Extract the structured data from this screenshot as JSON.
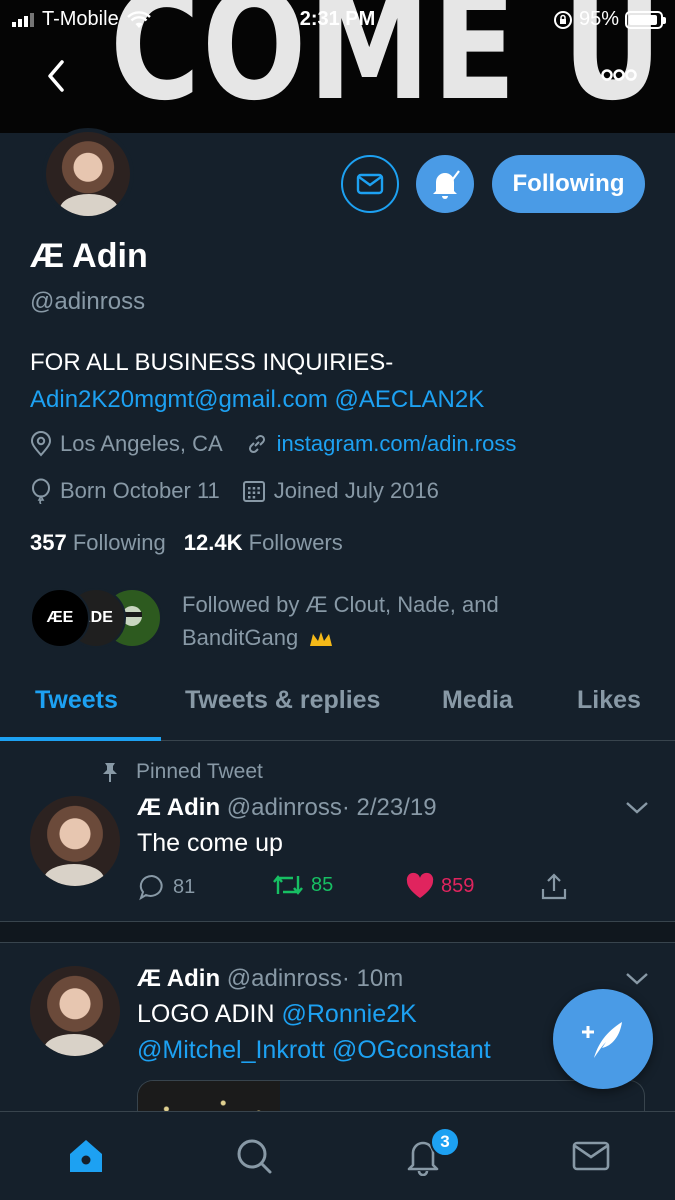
{
  "status_bar": {
    "carrier": "T-Mobile",
    "time": "2:31 PM",
    "battery": "95%"
  },
  "banner": {
    "art_text": "COME UP"
  },
  "profile": {
    "name": "Æ Adin",
    "handle": "@adinross",
    "buttons": {
      "following_label": "Following"
    },
    "bio": {
      "line1": "FOR ALL BUSINESS INQUIRIES-",
      "email": "Adin2K20mgmt@gmail.com",
      "mention": "@AECLAN2K"
    },
    "location": "Los Angeles, CA",
    "website": "instagram.com/adin.ross",
    "born": "Born October 11",
    "joined": "Joined July 2016",
    "stats": {
      "following_count": "357",
      "following_label": "Following",
      "followers_count": "12.4K",
      "followers_label": "Followers"
    },
    "followed_by": {
      "text": "Followed by Æ Clout, Nade, and BanditGang",
      "avatar1": "ÆE",
      "avatar2": "ADE"
    }
  },
  "tabs": [
    {
      "label": "Tweets"
    },
    {
      "label": "Tweets & replies"
    },
    {
      "label": "Media"
    },
    {
      "label": "Likes"
    }
  ],
  "tweets": [
    {
      "pinned_label": "Pinned Tweet",
      "name": "Æ Adin",
      "handle": "@adinross",
      "date": "· 2/23/19",
      "text": "The come up",
      "replies": "81",
      "retweets": "85",
      "likes": "859"
    },
    {
      "name": "Æ Adin",
      "handle": "@adinross",
      "date": "· 10m",
      "text_plain": "LOGO ADIN",
      "mention1": "@Ronnie2K",
      "mention2": "@Mitchel_Inkrott",
      "mention3": "@OGconstant"
    }
  ],
  "bottom_nav": {
    "notifications_badge": "3"
  },
  "colors": {
    "background": "#15202b",
    "accent": "#1da1f2",
    "button_blue": "#4a9be6",
    "muted_text": "#8899a6",
    "retweet_green": "#17bf63",
    "like_red": "#e0245e"
  }
}
